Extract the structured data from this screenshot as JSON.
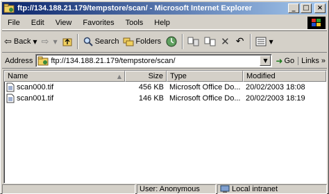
{
  "window": {
    "title": "ftp://134.188.21.179/tempstore/scan/ - Microsoft Internet Explorer",
    "minimize": "_",
    "maximize": "□",
    "close": "×"
  },
  "menu": [
    "File",
    "Edit",
    "View",
    "Favorites",
    "Tools",
    "Help"
  ],
  "toolbar": {
    "back": "Back",
    "search": "Search",
    "folders": "Folders"
  },
  "address": {
    "label": "Address",
    "value": "ftp://134.188.21.179/tempstore/scan/",
    "go": "Go",
    "links": "Links »"
  },
  "list": {
    "columns": {
      "name": "Name",
      "size": "Size",
      "type": "Type",
      "modified": "Modified"
    },
    "rows": [
      {
        "name": "scan000.tif",
        "size": "456 KB",
        "type": "Microsoft Office Do...",
        "modified": "20/02/2003 18:08"
      },
      {
        "name": "scan001.tif",
        "size": "146 KB",
        "type": "Microsoft Office Do...",
        "modified": "20/02/2003 18:19"
      }
    ]
  },
  "status": {
    "main": "",
    "user": "User: Anonymous",
    "zone": "Local intranet"
  },
  "colors": {
    "titlebar_start": "#0a246a",
    "titlebar_end": "#a6caf0",
    "chrome": "#d4d0c8"
  }
}
